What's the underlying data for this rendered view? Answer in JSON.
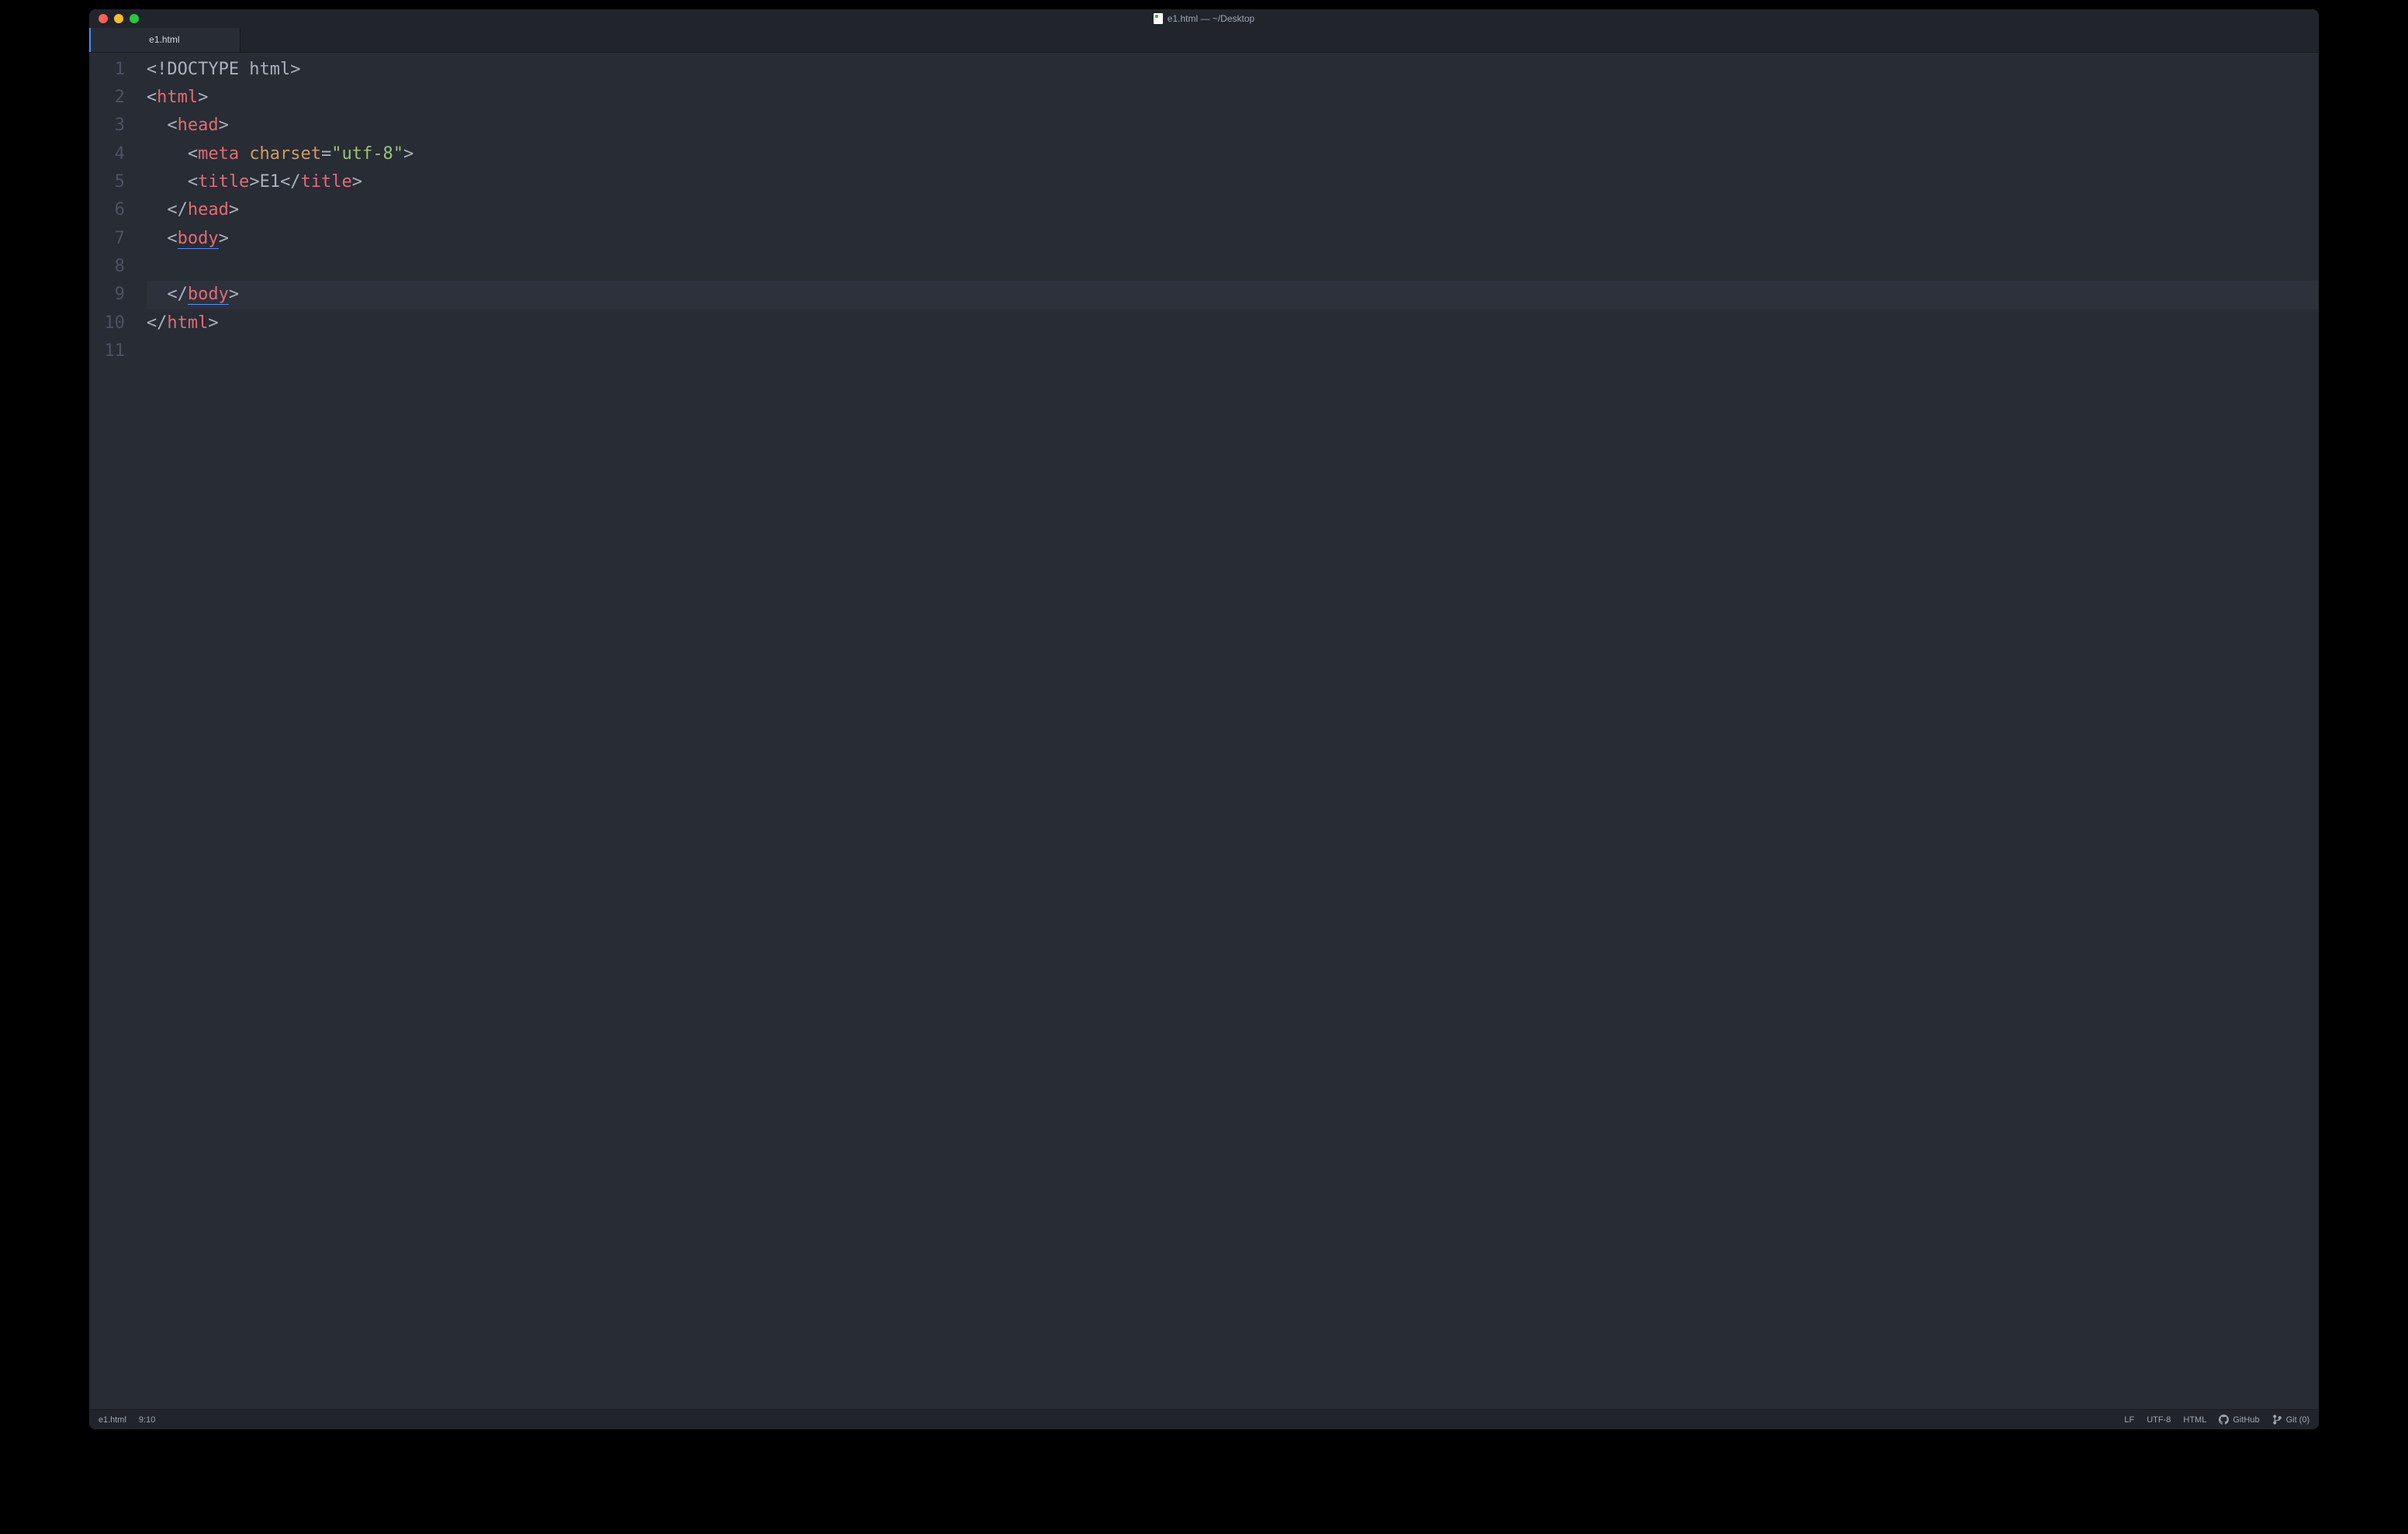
{
  "window": {
    "title": "e1.html — ~/Desktop"
  },
  "tabs": [
    {
      "label": "e1.html"
    }
  ],
  "editor": {
    "line_numbers": [
      "1",
      "2",
      "3",
      "4",
      "5",
      "6",
      "7",
      "8",
      "9",
      "10",
      "11"
    ],
    "highlighted_line_index": 8,
    "lines": [
      [
        {
          "t": "<!",
          "c": "p"
        },
        {
          "t": "DOCTYPE html",
          "c": "doc"
        },
        {
          "t": ">",
          "c": "p"
        }
      ],
      [
        {
          "t": "<",
          "c": "p"
        },
        {
          "t": "html",
          "c": "tag"
        },
        {
          "t": ">",
          "c": "p"
        }
      ],
      [
        {
          "t": "  ",
          "c": "p"
        },
        {
          "t": "<",
          "c": "p"
        },
        {
          "t": "head",
          "c": "tag"
        },
        {
          "t": ">",
          "c": "p"
        }
      ],
      [
        {
          "t": "    ",
          "c": "p"
        },
        {
          "t": "<",
          "c": "p"
        },
        {
          "t": "meta",
          "c": "tag"
        },
        {
          "t": " ",
          "c": "p"
        },
        {
          "t": "charset",
          "c": "attr"
        },
        {
          "t": "=",
          "c": "p"
        },
        {
          "t": "\"utf-8\"",
          "c": "str"
        },
        {
          "t": ">",
          "c": "p"
        }
      ],
      [
        {
          "t": "    ",
          "c": "p"
        },
        {
          "t": "<",
          "c": "p"
        },
        {
          "t": "title",
          "c": "tag"
        },
        {
          "t": ">",
          "c": "p"
        },
        {
          "t": "E1",
          "c": "txt"
        },
        {
          "t": "</",
          "c": "p"
        },
        {
          "t": "title",
          "c": "tag"
        },
        {
          "t": ">",
          "c": "p"
        }
      ],
      [
        {
          "t": "  ",
          "c": "p"
        },
        {
          "t": "</",
          "c": "p"
        },
        {
          "t": "head",
          "c": "tag"
        },
        {
          "t": ">",
          "c": "p"
        }
      ],
      [
        {
          "t": "  ",
          "c": "p"
        },
        {
          "t": "<",
          "c": "p"
        },
        {
          "t": "body",
          "c": "tag",
          "u": true
        },
        {
          "t": ">",
          "c": "p"
        }
      ],
      [
        {
          "t": "",
          "c": "p"
        }
      ],
      [
        {
          "t": "  ",
          "c": "p"
        },
        {
          "t": "</",
          "c": "p"
        },
        {
          "t": "body",
          "c": "tag",
          "u": true
        },
        {
          "t": ">",
          "c": "p"
        }
      ],
      [
        {
          "t": "</",
          "c": "p"
        },
        {
          "t": "html",
          "c": "tag"
        },
        {
          "t": ">",
          "c": "p"
        }
      ],
      [
        {
          "t": "",
          "c": "p"
        }
      ]
    ]
  },
  "statusbar": {
    "left": {
      "filename": "e1.html",
      "cursor": "9:10"
    },
    "right": {
      "line_ending": "LF",
      "encoding": "UTF-8",
      "language": "HTML",
      "github": "GitHub",
      "git": "Git (0)"
    }
  }
}
